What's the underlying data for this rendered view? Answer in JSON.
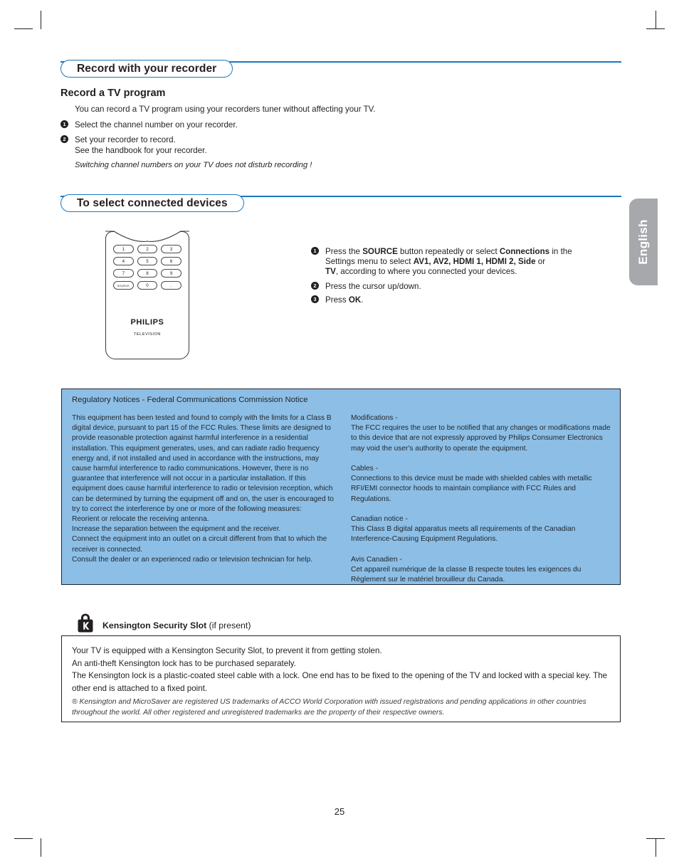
{
  "page": {
    "number": "25",
    "language_tab": "English"
  },
  "section1": {
    "header": "Record with your recorder",
    "subheading": "Record a TV program",
    "intro": "You can record a TV program using your recorders tuner without affecting your TV.",
    "steps": [
      {
        "num": "1",
        "lines": [
          "Select the channel number on your recorder."
        ]
      },
      {
        "num": "2",
        "lines": [
          "Set your recorder to record.",
          "See the handbook for your recorder."
        ]
      }
    ],
    "note": "Switching channel numbers on your TV does not disturb recording !"
  },
  "section2": {
    "header": "To select connected devices",
    "remote": {
      "keys": [
        "1",
        "2",
        "3",
        "4",
        "5",
        "6",
        "7",
        "8",
        "9",
        "SOURCE",
        "0",
        "."
      ],
      "brand": "PHILIPS",
      "brand_sub": "TELEVISION"
    },
    "steps": [
      {
        "num": "1",
        "lines": [
          "Press the SOURCE button repeatedly or select Connections in the",
          "Settings menu to select AV1, AV2, HDMI 1, HDMI 2, Side or",
          "TV, according to where you connected your devices."
        ]
      },
      {
        "num": "2",
        "lines": [
          "Press the cursor up/down."
        ]
      },
      {
        "num": "3",
        "lines": [
          "Press OK."
        ]
      }
    ]
  },
  "fcc": {
    "title": "Regulatory Notices - Federal Communications Commission Notice",
    "left_paragraphs": [
      "This equipment has been tested and found to comply with the limits for a Class B digital device, pursuant to part 15 of the FCC Rules. These limits are designed to provide reasonable protection against harmful interference in a residential installation. This equipment generates, uses, and can radiate radio frequency energy and, if not installed and used in accordance with the instructions, may cause harmful interference to radio communications. However, there is no guarantee that interference will not occur in a particular installation. If this equipment does cause harmful interference to radio or television reception, which can be determined by turning the equipment off and on, the user is encouraged to try to correct the interference by one or more of the following measures:",
      "Reorient or relocate the receiving antenna.",
      "Increase the separation between the equipment and the receiver.",
      "Connect the equipment into an outlet on a circuit different from that to which the receiver is connected.",
      "Consult the dealer or an experienced radio or television technician for help."
    ],
    "right_blocks": [
      {
        "heading": "Modifications -",
        "text": "The FCC requires the user to be notified that any changes or modifications made to this device that are not expressly approved by Philips Consumer Electronics may void the user's authority to operate the equipment."
      },
      {
        "heading": "Cables -",
        "text": "Connections to this device must be made with shielded cables with metallic RFI/EMI connector hoods to maintain compliance with FCC Rules and Regulations."
      },
      {
        "heading": "Canadian notice -",
        "text": "This Class B digital apparatus meets all requirements of the Canadian Interference-Causing Equipment Regulations."
      },
      {
        "heading": "Avis Canadien -",
        "text": "Cet appareil numérique de la classe B respecte toutes les exigences du Règlement sur le matériel brouilleur du Canada."
      }
    ],
    "background_color": "#8dbfe6"
  },
  "kensington": {
    "title_bold": "Kensington Security Slot",
    "title_light": "(if present)",
    "paragraphs": [
      "Your TV is equipped with a Kensington Security Slot, to prevent it from getting stolen.",
      "An anti-theft Kensington lock has to be purchased separately.",
      "The Kensington lock is a plastic-coated steel cable with a lock. One end has to be fixed to the opening of the TV and locked with a special key. The other end is attached to a fixed point."
    ],
    "trademark": "® Kensington and MicroSaver are registered US trademarks of ACCO World Corporation with issued registrations and pending applications in other countries throughout the world. All other registered and unregistered trademarks are the property of their respective owners."
  },
  "colors": {
    "accent_blue": "#1878c0",
    "fcc_blue": "#8dbfe6",
    "tab_gray": "#a6a8ab",
    "ink": "#231f20"
  }
}
